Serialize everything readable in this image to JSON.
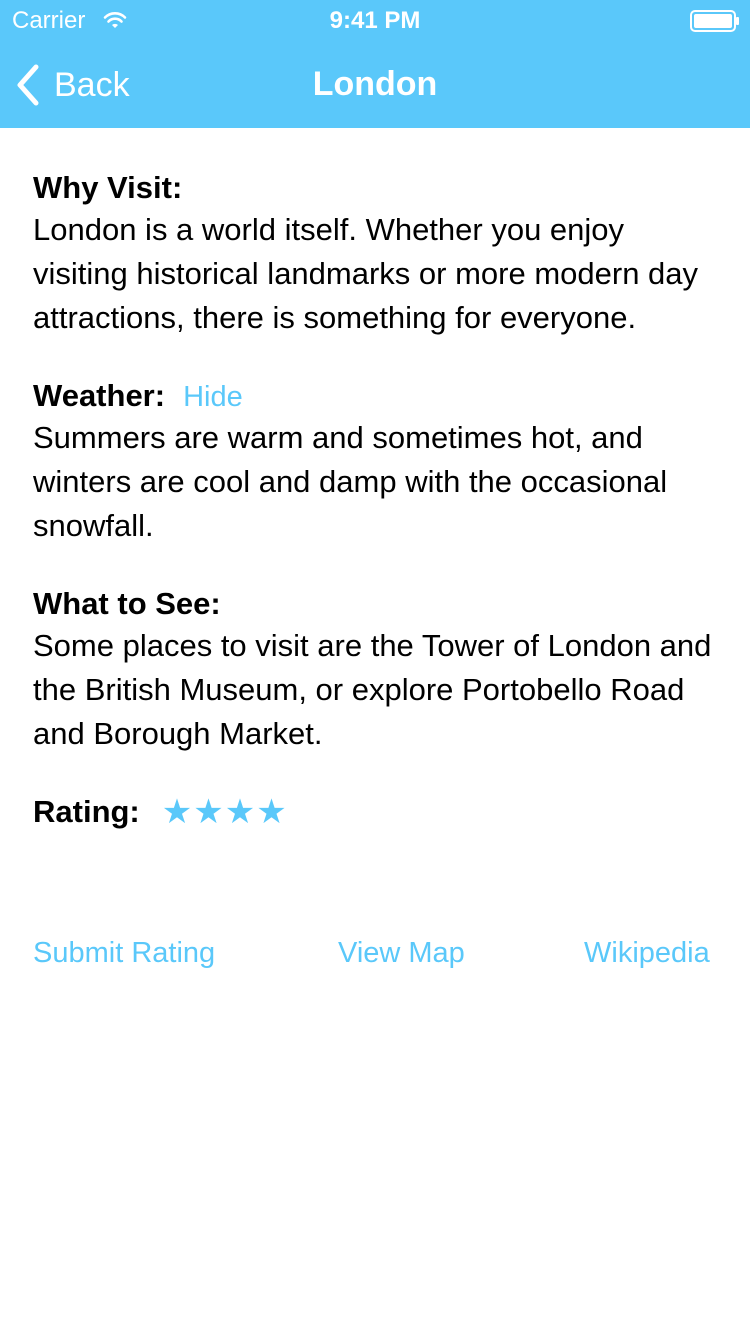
{
  "status_bar": {
    "carrier": "Carrier",
    "time": "9:41 PM",
    "wifi_icon": "wifi-icon",
    "battery_icon": "battery-icon"
  },
  "nav": {
    "back_label": "Back",
    "title": "London",
    "back_icon": "chevron-left-icon"
  },
  "sections": {
    "why_visit": {
      "heading": "Why Visit:",
      "text": "London is a world itself. Whether you enjoy visiting historical landmarks or more modern day attractions, there is something for everyone."
    },
    "weather": {
      "heading": "Weather:",
      "toggle_label": "Hide",
      "text": "Summers are warm and sometimes hot, and winters are cool and damp with the occasional snowfall."
    },
    "what_to_see": {
      "heading": "What to See:",
      "text": "Some places to visit are the Tower of London and the British Museum, or explore Portobello Road and Borough Market."
    },
    "rating": {
      "heading": "Rating:",
      "stars": [
        "★",
        "★",
        "★",
        "★"
      ],
      "value": 4
    }
  },
  "actions": {
    "submit_rating": "Submit Rating",
    "view_map": "View Map",
    "wikipedia": "Wikipedia"
  },
  "colors": {
    "accent": "#5ac8fa",
    "nav_bg": "#5ac8fa",
    "text": "#000000",
    "background": "#ffffff"
  }
}
